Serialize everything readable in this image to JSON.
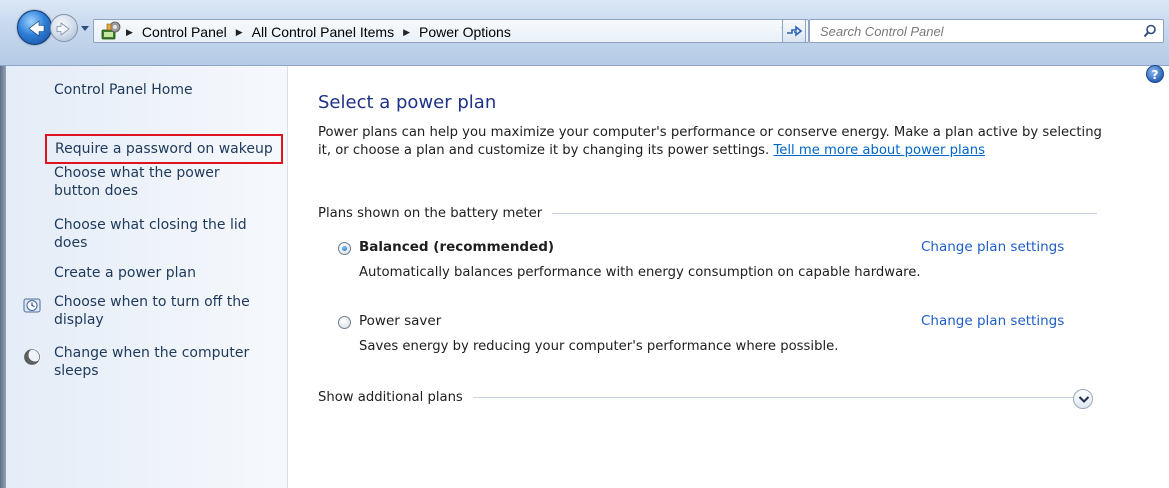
{
  "address_bar": {
    "breadcrumbs": [
      "Control Panel",
      "All Control Panel Items",
      "Power Options"
    ],
    "search_placeholder": "Search Control Panel"
  },
  "left_nav": {
    "home": "Control Panel Home",
    "links": [
      "Require a password on wakeup",
      "Choose what the power button does",
      "Choose what closing the lid does",
      "Create a power plan",
      "Choose when to turn off the display",
      "Change when the computer sleeps"
    ]
  },
  "main": {
    "title": "Select a power plan",
    "intro": "Power plans can help you maximize your computer's performance or conserve energy. Make a plan active by selecting it, or choose a plan and customize it by changing its power settings.",
    "intro_link": "Tell me more about power plans",
    "group_label": "Plans shown on the battery meter",
    "plans": [
      {
        "name": "Balanced (recommended)",
        "description": "Automatically balances performance with energy consumption on capable hardware.",
        "selected": true,
        "link": "Change plan settings"
      },
      {
        "name": "Power saver",
        "description": "Saves energy by reducing your computer's performance where possible.",
        "selected": false,
        "link": "Change plan settings"
      }
    ],
    "additional_plans_label": "Show additional plans"
  },
  "colors": {
    "title": "#1e3287",
    "link": "#1e5ec8",
    "highlight_border": "#e0141e"
  }
}
